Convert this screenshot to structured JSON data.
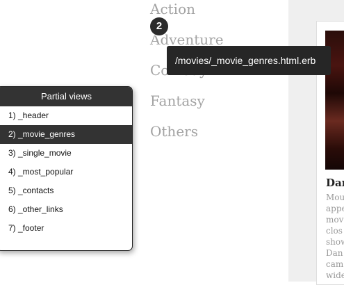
{
  "genres": [
    "Action",
    "Adventure",
    "Comedy",
    "Fantasy",
    "Others"
  ],
  "step_badge": "2",
  "tooltip": {
    "text": "/movies/_movie_genres.html.erb"
  },
  "partials_panel": {
    "title": "Partial views",
    "items": [
      "1) _header",
      "2) _movie_genres",
      "3) _single_movie",
      "4) _most_popular",
      "5) _contacts",
      "6) _other_links",
      "7) _footer"
    ],
    "active_index": 1
  },
  "movie_card": {
    "title": "Dan",
    "description_lines": [
      "Mou",
      "appe",
      "mov",
      "clos",
      "show",
      "Dan",
      "cam",
      "wide"
    ]
  },
  "colors": {
    "panel_dark": "#333333",
    "tooltip_bg": "#262626",
    "genre_text": "#a3a3a3",
    "gutter_bg": "#efefef"
  }
}
